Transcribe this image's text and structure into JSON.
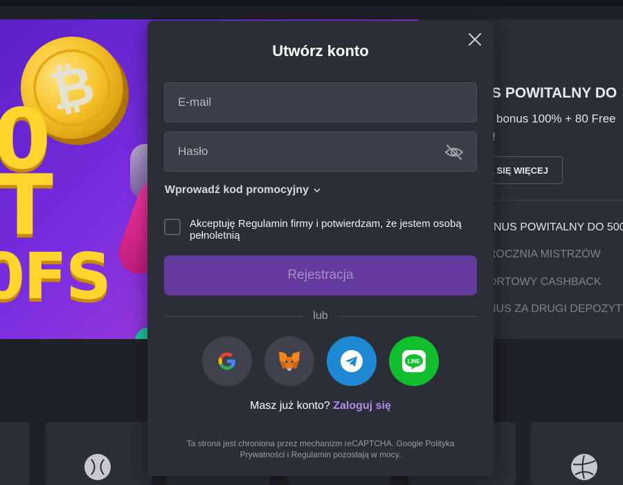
{
  "banner": {
    "coin_symbol": "₿",
    "text_line1": "0",
    "text_line2": "T",
    "text_line3": "0FS"
  },
  "promo_panel": {
    "title": "S POWITALNY DO",
    "description": "bonus 100% + 80 Free",
    "description_cont": "!",
    "learn_more_label": "Z SIĘ WIĘCEJ",
    "items": [
      {
        "label": "NUS POWITALNY DO 500",
        "active": true
      },
      {
        "label": "ROCZNIA MISTRZÓW",
        "active": false
      },
      {
        "label": "ORTOWY CASHBACK",
        "active": false
      },
      {
        "label": "NUS ZA DRUGI DEPOZYT",
        "active": false
      }
    ]
  },
  "modal": {
    "title": "Utwórz konto",
    "email_placeholder": "E-mail",
    "password_placeholder": "Hasło",
    "promo_code_label": "Wprowadź kod promocyjny",
    "terms_text": "Akceptuję Regulamin firmy i potwierdzam, że jestem osobą pełnoletnią",
    "terms_checked": false,
    "register_label": "Rejestracja",
    "or_label": "lub",
    "social": [
      {
        "name": "Google",
        "icon": "google-icon"
      },
      {
        "name": "MetaMask",
        "icon": "metamask-icon"
      },
      {
        "name": "Telegram",
        "icon": "telegram-icon"
      },
      {
        "name": "LINE",
        "icon": "line-icon",
        "label": "LINE"
      }
    ],
    "have_account_text": "Masz już konto?",
    "login_link_label": "Zaloguj się",
    "recaptcha_note": "Ta strona jest chroniona przez mechanizm reCAPTCHA. Google Polityka Prywatności i Regulamin pozostają w mocy."
  },
  "colors": {
    "modal_bg": "#2b2e36",
    "accent_purple": "#643a9e",
    "link_purple": "#b58af0",
    "telegram_blue": "#1e88d2",
    "line_green": "#11bf2e"
  }
}
